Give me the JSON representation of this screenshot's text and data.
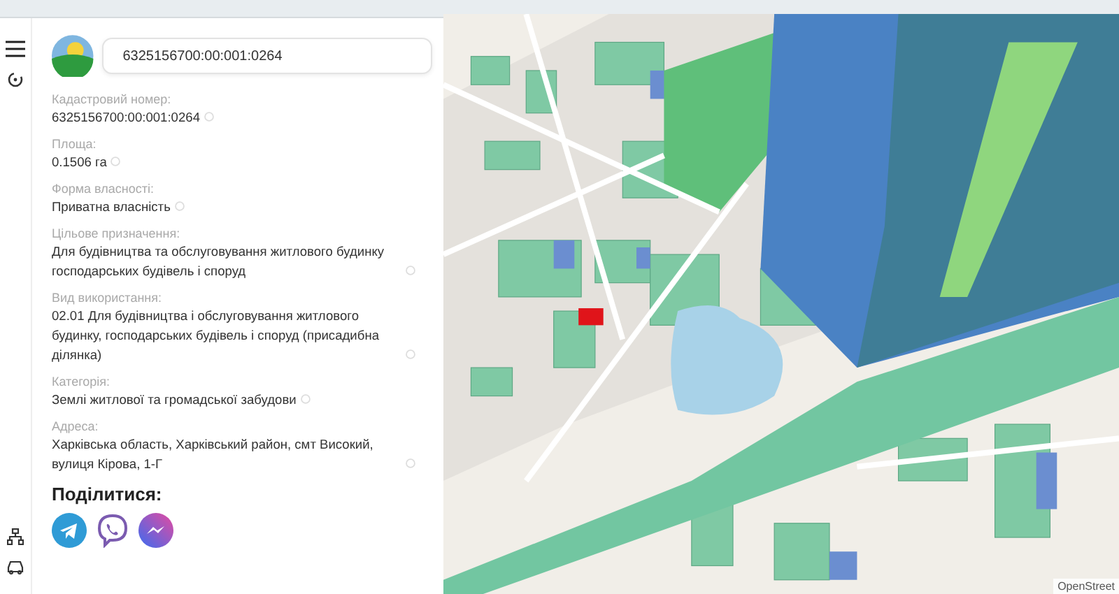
{
  "search": {
    "value": "6325156700:00:001:0264"
  },
  "fields": [
    {
      "label": "Кадастровий номер:",
      "value": "6325156700:00:001:0264"
    },
    {
      "label": "Площа:",
      "value": "0.1506 га"
    },
    {
      "label": "Форма власності:",
      "value": "Приватна власність"
    },
    {
      "label": "Цільове призначення:",
      "value": "Для будівництва та обслуговування житлового будинку господарських будівель і споруд"
    },
    {
      "label": "Вид використання:",
      "value": "02.01 Для будівництва і обслуговування житлового будинку, господарських будівель і споруд (присадибна ділянка)"
    },
    {
      "label": "Категорія:",
      "value": "Землі житлової та громадської забудови"
    },
    {
      "label": "Адреса:",
      "value": "Харківська область, Харківський район, смт Високий, вулиця Кірова, 1-Г"
    }
  ],
  "share": {
    "title": "Поділитися:",
    "buttons": [
      {
        "kind": "telegram"
      },
      {
        "kind": "viber"
      },
      {
        "kind": "messenger"
      }
    ]
  },
  "map": {
    "attribution": "OpenStreet"
  }
}
